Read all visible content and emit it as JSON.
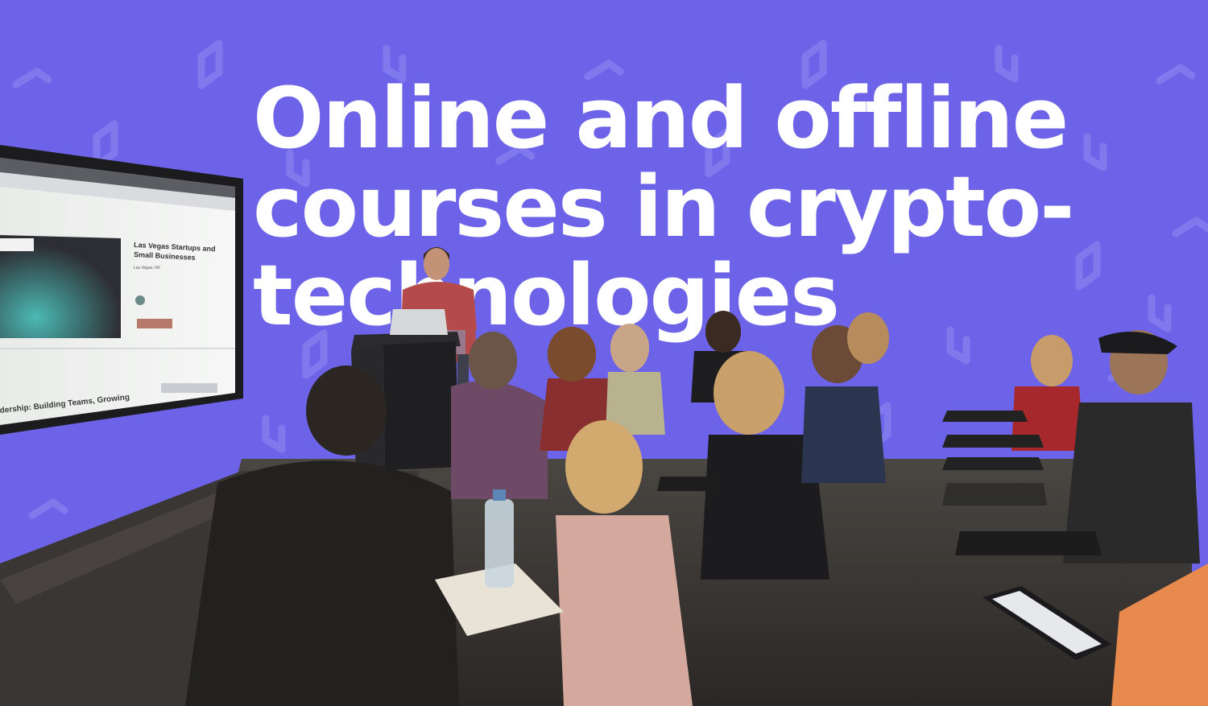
{
  "headline": {
    "line1": "Online and offline",
    "line2": "courses in crypto-",
    "line3": "technologies"
  },
  "screen": {
    "event_title_1": "Las Vegas Startups and",
    "event_title_2": "Small Businesses",
    "event_location": "Las Vegas, NV",
    "footer_text": "dership: Building Teams, Growing"
  },
  "colors": {
    "background": "#6c63e8",
    "headline": "#ffffff",
    "pattern": "#a9a4f5"
  },
  "icons": [
    "logo-pattern-icon",
    "laptop-logo-icon"
  ]
}
